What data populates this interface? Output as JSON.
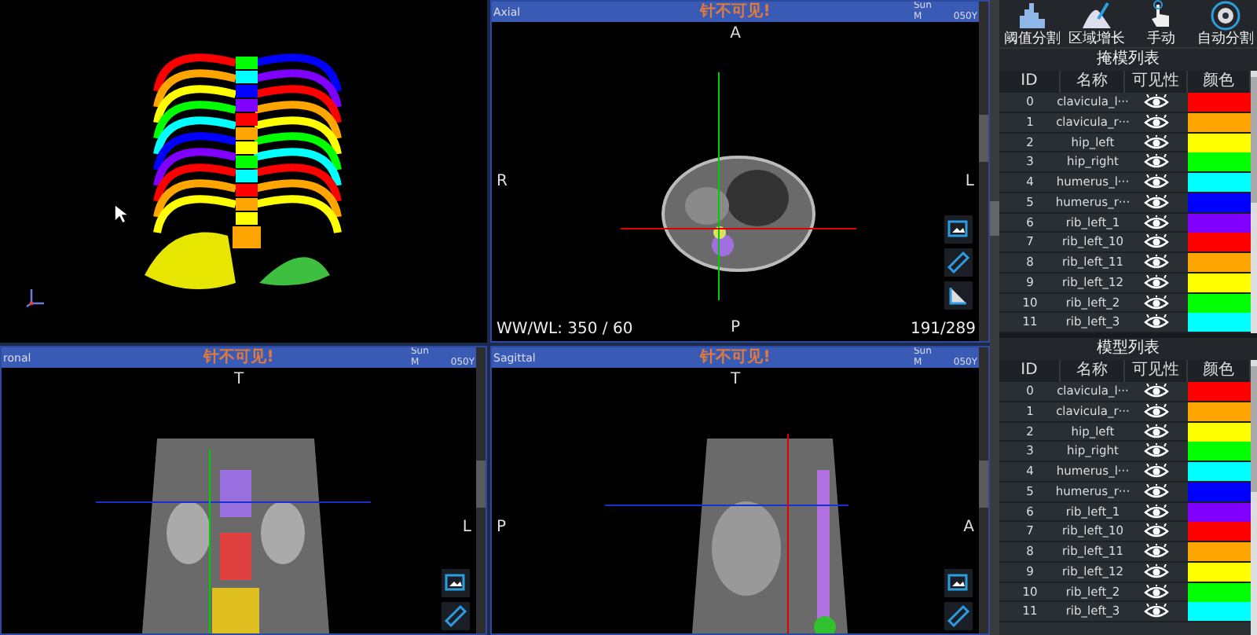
{
  "viewports": [
    {
      "kind": "rendering"
    },
    {
      "kind": "axial",
      "label": "Axial",
      "title": "针不可见!",
      "day": "Sun",
      "sex": "M",
      "age": "050Y",
      "top": "A",
      "left": "R",
      "right": "L",
      "bottom": "P",
      "window_level": "WW/WL: 350 / 60",
      "slice": "191/289"
    },
    {
      "kind": "coronal",
      "label": "ronal",
      "title": "针不可见!",
      "day": "Sun",
      "sex": "M",
      "age": "050Y",
      "top": "T",
      "right": "L"
    },
    {
      "kind": "sagittal",
      "label": "Sagittal",
      "title": "针不可见!",
      "day": "Sun",
      "sex": "M",
      "age": "050Y",
      "top": "T",
      "left": "P",
      "right": "A"
    }
  ],
  "toolbar": [
    {
      "kind": "threshold",
      "label": "阈值分割"
    },
    {
      "kind": "region",
      "label": "区域增长"
    },
    {
      "kind": "manual",
      "label": "手动"
    },
    {
      "kind": "auto",
      "label": "自动分割"
    }
  ],
  "mask_list": {
    "title": "掩模列表",
    "columns": [
      "ID",
      "名称",
      "可见性",
      "颜色"
    ],
    "rows": [
      {
        "id": "0",
        "name": "clavicula_l···",
        "visible": true,
        "color": "#ff0000"
      },
      {
        "id": "1",
        "name": "clavicula_r···",
        "visible": true,
        "color": "#ffa500"
      },
      {
        "id": "2",
        "name": "hip_left",
        "visible": true,
        "color": "#ffff00"
      },
      {
        "id": "3",
        "name": "hip_right",
        "visible": true,
        "color": "#00ff00"
      },
      {
        "id": "4",
        "name": "humerus_l···",
        "visible": true,
        "color": "#00ffff"
      },
      {
        "id": "5",
        "name": "humerus_r···",
        "visible": true,
        "color": "#0000ff"
      },
      {
        "id": "6",
        "name": "rib_left_1",
        "visible": true,
        "color": "#8000ff"
      },
      {
        "id": "7",
        "name": "rib_left_10",
        "visible": true,
        "color": "#ff0000"
      },
      {
        "id": "8",
        "name": "rib_left_11",
        "visible": true,
        "color": "#ffa500"
      },
      {
        "id": "9",
        "name": "rib_left_12",
        "visible": true,
        "color": "#ffff00"
      },
      {
        "id": "10",
        "name": "rib_left_2",
        "visible": true,
        "color": "#00ff00"
      },
      {
        "id": "11",
        "name": "rib_left_3",
        "visible": true,
        "color": "#00ffff"
      }
    ]
  },
  "model_list": {
    "title": "模型列表",
    "columns": [
      "ID",
      "名称",
      "可见性",
      "颜色"
    ],
    "rows": [
      {
        "id": "0",
        "name": "clavicula_l···",
        "visible": true,
        "color": "#ff0000"
      },
      {
        "id": "1",
        "name": "clavicula_r···",
        "visible": true,
        "color": "#ffa500"
      },
      {
        "id": "2",
        "name": "hip_left",
        "visible": true,
        "color": "#ffff00"
      },
      {
        "id": "3",
        "name": "hip_right",
        "visible": true,
        "color": "#00ff00"
      },
      {
        "id": "4",
        "name": "humerus_l···",
        "visible": true,
        "color": "#00ffff"
      },
      {
        "id": "5",
        "name": "humerus_r···",
        "visible": true,
        "color": "#0000ff"
      },
      {
        "id": "6",
        "name": "rib_left_1",
        "visible": true,
        "color": "#8000ff"
      },
      {
        "id": "7",
        "name": "rib_left_10",
        "visible": true,
        "color": "#ff0000"
      },
      {
        "id": "8",
        "name": "rib_left_11",
        "visible": true,
        "color": "#ffa500"
      },
      {
        "id": "9",
        "name": "rib_left_12",
        "visible": true,
        "color": "#ffff00"
      },
      {
        "id": "10",
        "name": "rib_left_2",
        "visible": true,
        "color": "#00ff00"
      },
      {
        "id": "11",
        "name": "rib_left_3",
        "visible": true,
        "color": "#00ffff"
      }
    ]
  }
}
